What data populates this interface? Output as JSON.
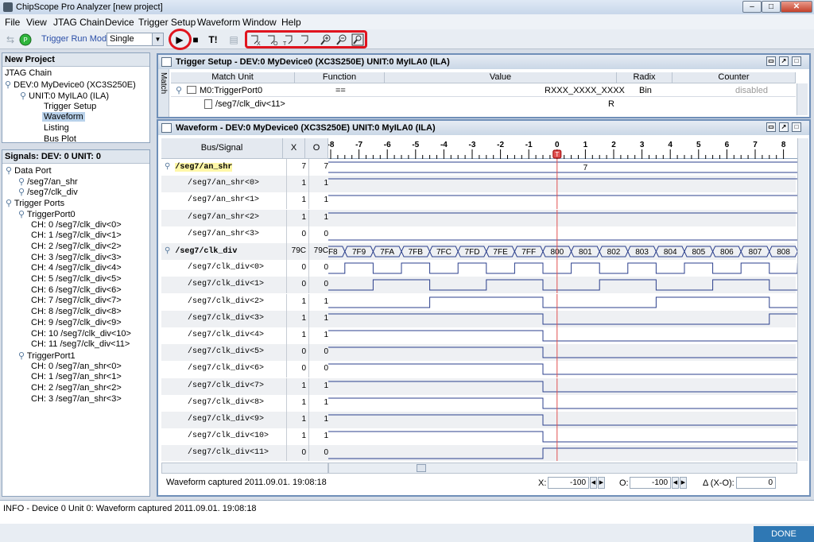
{
  "window": {
    "title": "ChipScope Pro Analyzer [new project]",
    "minimize": "–",
    "maximize": "□",
    "close": "✕"
  },
  "menu": [
    "File",
    "View",
    "JTAG Chain",
    "Device",
    "Trigger Setup",
    "Waveform",
    "Window",
    "Help"
  ],
  "toolbar": {
    "run_mode_label": "Trigger Run Mode:",
    "run_mode_value": "Single",
    "run_icon": "play-icon",
    "stop_icon": "stop-icon",
    "trigger_now_label": "T!",
    "accent": "#e0141e"
  },
  "project": {
    "title": "New Project",
    "tree": [
      {
        "label": "JTAG Chain",
        "depth": 0
      },
      {
        "label": "DEV:0 MyDevice0 (XC3S250E)",
        "depth": 0
      },
      {
        "label": "UNIT:0 MyILA0 (ILA)",
        "depth": 1
      },
      {
        "label": "Trigger Setup",
        "depth": 2
      },
      {
        "label": "Waveform",
        "depth": 2,
        "selected": true
      },
      {
        "label": "Listing",
        "depth": 2
      },
      {
        "label": "Bus Plot",
        "depth": 2
      }
    ]
  },
  "signals": {
    "title": "Signals: DEV: 0 UNIT: 0",
    "tree": [
      {
        "label": "Data Port",
        "depth": 0
      },
      {
        "label": "/seg7/an_shr",
        "depth": 1
      },
      {
        "label": "/seg7/clk_div",
        "depth": 1
      },
      {
        "label": "Trigger Ports",
        "depth": 0
      },
      {
        "label": "TriggerPort0",
        "depth": 1
      },
      {
        "label": "CH: 0 /seg7/clk_div<0>",
        "depth": 2
      },
      {
        "label": "CH: 1 /seg7/clk_div<1>",
        "depth": 2
      },
      {
        "label": "CH: 2 /seg7/clk_div<2>",
        "depth": 2
      },
      {
        "label": "CH: 3 /seg7/clk_div<3>",
        "depth": 2
      },
      {
        "label": "CH: 4 /seg7/clk_div<4>",
        "depth": 2
      },
      {
        "label": "CH: 5 /seg7/clk_div<5>",
        "depth": 2
      },
      {
        "label": "CH: 6 /seg7/clk_div<6>",
        "depth": 2
      },
      {
        "label": "CH: 7 /seg7/clk_div<7>",
        "depth": 2
      },
      {
        "label": "CH: 8 /seg7/clk_div<8>",
        "depth": 2
      },
      {
        "label": "CH: 9 /seg7/clk_div<9>",
        "depth": 2
      },
      {
        "label": "CH: 10 /seg7/clk_div<10>",
        "depth": 2
      },
      {
        "label": "CH: 11 /seg7/clk_div<11>",
        "depth": 2
      },
      {
        "label": "TriggerPort1",
        "depth": 1
      },
      {
        "label": "CH: 0 /seg7/an_shr<0>",
        "depth": 2
      },
      {
        "label": "CH: 1 /seg7/an_shr<1>",
        "depth": 2
      },
      {
        "label": "CH: 2 /seg7/an_shr<2>",
        "depth": 2
      },
      {
        "label": "CH: 3 /seg7/an_shr<3>",
        "depth": 2
      }
    ]
  },
  "trigger_setup": {
    "title": "Trigger Setup - DEV:0 MyDevice0 (XC3S250E) UNIT:0 MyILA0 (ILA)",
    "side_label": "Match",
    "headers": [
      "Match Unit",
      "Function",
      "Value",
      "Radix",
      "Counter"
    ],
    "rows": [
      {
        "unit": "M0:TriggerPort0",
        "function": "==",
        "value": "RXXX_XXXX_XXXX",
        "radix": "Bin",
        "counter": "disabled"
      },
      {
        "unit": "/seg7/clk_div<11>",
        "function": "",
        "value": "R",
        "radix": "",
        "counter": ""
      }
    ]
  },
  "waveform": {
    "title": "Waveform - DEV:0 MyDevice0 (XC3S250E) UNIT:0 MyILA0 (ILA)",
    "headers": {
      "bus": "Bus/Signal",
      "x": "X",
      "o": "O"
    },
    "ticks": [
      "-8",
      "-7",
      "-6",
      "-5",
      "-4",
      "-3",
      "-2",
      "-1",
      "0",
      "1",
      "2",
      "3",
      "4",
      "5",
      "6",
      "7",
      "8"
    ],
    "trigger_marker": "T",
    "signals": [
      {
        "name": "/seg7/an_shr",
        "bus": true,
        "x": "7",
        "o": "7",
        "bus_values": [
          "7"
        ]
      },
      {
        "name": "/seg7/an_shr<0>",
        "x": "1",
        "o": "1",
        "wave": "1"
      },
      {
        "name": "/seg7/an_shr<1>",
        "x": "1",
        "o": "1",
        "wave": "1"
      },
      {
        "name": "/seg7/an_shr<2>",
        "x": "1",
        "o": "1",
        "wave": "1"
      },
      {
        "name": "/seg7/an_shr<3>",
        "x": "0",
        "o": "0",
        "wave": "0"
      },
      {
        "name": "/seg7/clk_div",
        "bus": true,
        "x": "79C",
        "o": "79C",
        "bus_values": [
          "7F8",
          "7F9",
          "7FA",
          "7FB",
          "7FC",
          "7FD",
          "7FE",
          "7FF",
          "800",
          "801",
          "802",
          "803",
          "804",
          "805",
          "806",
          "807",
          "808"
        ]
      },
      {
        "name": "/seg7/clk_div<0>",
        "x": "0",
        "o": "0",
        "wave": "010101010101010101"
      },
      {
        "name": "/seg7/clk_div<1>",
        "x": "0",
        "o": "0",
        "wave": "001100110011001100"
      },
      {
        "name": "/seg7/clk_div<2>",
        "x": "1",
        "o": "1",
        "wave": "000011110000111100"
      },
      {
        "name": "/seg7/clk_div<3>",
        "x": "1",
        "o": "1",
        "wave": "111111110000000011"
      },
      {
        "name": "/seg7/clk_div<4>",
        "x": "1",
        "o": "1",
        "wave": "111111110000000000"
      },
      {
        "name": "/seg7/clk_div<5>",
        "x": "0",
        "o": "0",
        "wave": "111111110000000000"
      },
      {
        "name": "/seg7/clk_div<6>",
        "x": "0",
        "o": "0",
        "wave": "111111110000000000"
      },
      {
        "name": "/seg7/clk_div<7>",
        "x": "1",
        "o": "1",
        "wave": "111111110000000000"
      },
      {
        "name": "/seg7/clk_div<8>",
        "x": "1",
        "o": "1",
        "wave": "111111110000000000"
      },
      {
        "name": "/seg7/clk_div<9>",
        "x": "1",
        "o": "1",
        "wave": "111111110000000000"
      },
      {
        "name": "/seg7/clk_div<10>",
        "x": "1",
        "o": "1",
        "wave": "111111110000000000"
      },
      {
        "name": "/seg7/clk_div<11>",
        "x": "0",
        "o": "0",
        "wave": "000000001111111111"
      }
    ],
    "status": "Waveform captured 2011.09.01. 19:08:18",
    "cursor_x_label": "X:",
    "cursor_x_value": "-100",
    "cursor_o_label": "O:",
    "cursor_o_value": "-100",
    "delta_label": "Δ (X-O):",
    "delta_value": "0"
  },
  "console": {
    "message": "INFO - Device 0 Unit 0: Waveform captured 2011.09.01. 19:08:18"
  },
  "done_label": "DONE"
}
